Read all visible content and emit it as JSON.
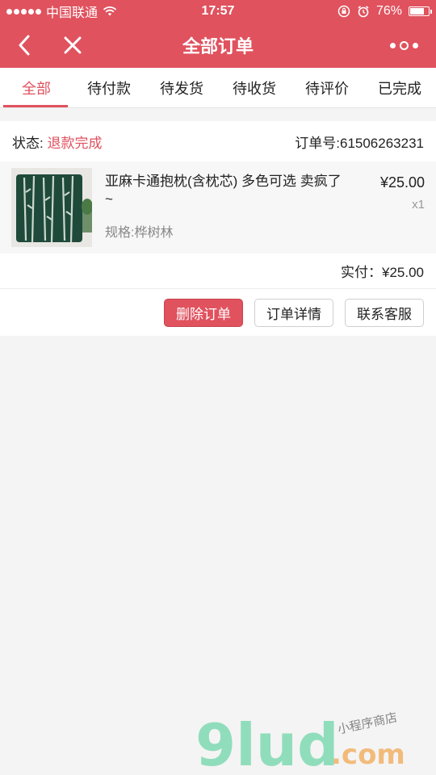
{
  "status_bar": {
    "carrier": "中国联通",
    "time": "17:57",
    "battery": "76%",
    "battery_level": 0.76
  },
  "nav": {
    "title": "全部订单"
  },
  "tabs": [
    {
      "label": "全部",
      "active": true
    },
    {
      "label": "待付款",
      "active": false
    },
    {
      "label": "待发货",
      "active": false
    },
    {
      "label": "待收货",
      "active": false
    },
    {
      "label": "待评价",
      "active": false
    },
    {
      "label": "已完成",
      "active": false
    }
  ],
  "order": {
    "status_label": "状态:",
    "status_value": "退款完成",
    "order_no": "订单号:61506263231",
    "product": {
      "name": "亚麻卡通抱枕(含枕芯) 多色可选 卖疯了~",
      "spec": "规格:桦树林",
      "price": "¥25.00",
      "qty": "x1"
    },
    "paid": "实付：¥25.00",
    "buttons": {
      "delete": "删除订单",
      "detail": "订单详情",
      "service": "联系客服"
    }
  },
  "watermark": {
    "brand": "9lud",
    "domain": ".com",
    "tagline": "小程序商店"
  },
  "colors": {
    "accent": "#e0525e",
    "background": "#f4f4f4"
  }
}
